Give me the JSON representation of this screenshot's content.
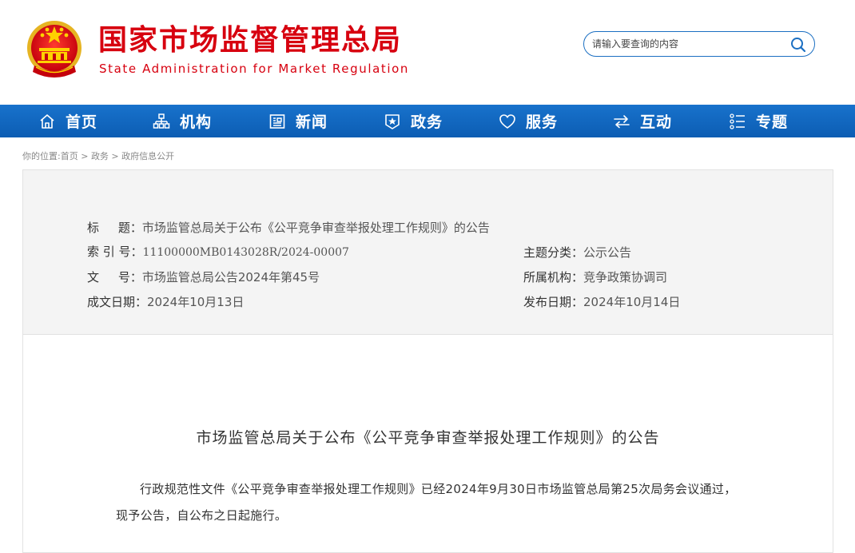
{
  "header": {
    "title": "国家市场监督管理总局",
    "subtitle": "State Administration for Market Regulation",
    "emblem_icon": "national-emblem-icon",
    "brand_color": "#d7000f"
  },
  "search": {
    "placeholder": "请输入要查询的内容",
    "icon": "search-icon",
    "border_color": "#1b6fc2"
  },
  "nav": {
    "color": "#0c5db3",
    "items": [
      {
        "label": "首页",
        "icon": "home-icon"
      },
      {
        "label": "机构",
        "icon": "org-chart-icon"
      },
      {
        "label": "新闻",
        "icon": "news-icon"
      },
      {
        "label": "政务",
        "icon": "government-affairs-icon"
      },
      {
        "label": "服务",
        "icon": "heart-icon"
      },
      {
        "label": "互动",
        "icon": "exchange-arrows-icon"
      },
      {
        "label": "专题",
        "icon": "topic-list-icon"
      }
    ]
  },
  "breadcrumb": {
    "prefix": "你的位置:",
    "items": [
      "首页",
      "政务",
      "政府信息公开"
    ],
    "separator": " > "
  },
  "info": {
    "title_label": "标     题：",
    "title_value": "市场监管总局关于公布《公平竞争审查举报处理工作规则》的公告",
    "index_label": "索 引 号：",
    "index_value": "11100000MB0143028R/2024-00007",
    "docno_label": "文     号：",
    "docno_value": "市场监管总局公告2024年第45号",
    "date_label": "成文日期：",
    "date_value": "2024年10月13日",
    "topic_label": "主题分类：",
    "topic_value": "公示公告",
    "org_label": "所属机构：",
    "org_value": "竞争政策协调司",
    "publish_label": "发布日期：",
    "publish_value": "2024年10月14日"
  },
  "article": {
    "title": "市场监管总局关于公布《公平竞争审查举报处理工作规则》的公告",
    "body": "行政规范性文件《公平竞争审查举报处理工作规则》已经2024年9月30日市场监管总局第25次局务会议通过，现予公告，自公布之日起施行。"
  }
}
